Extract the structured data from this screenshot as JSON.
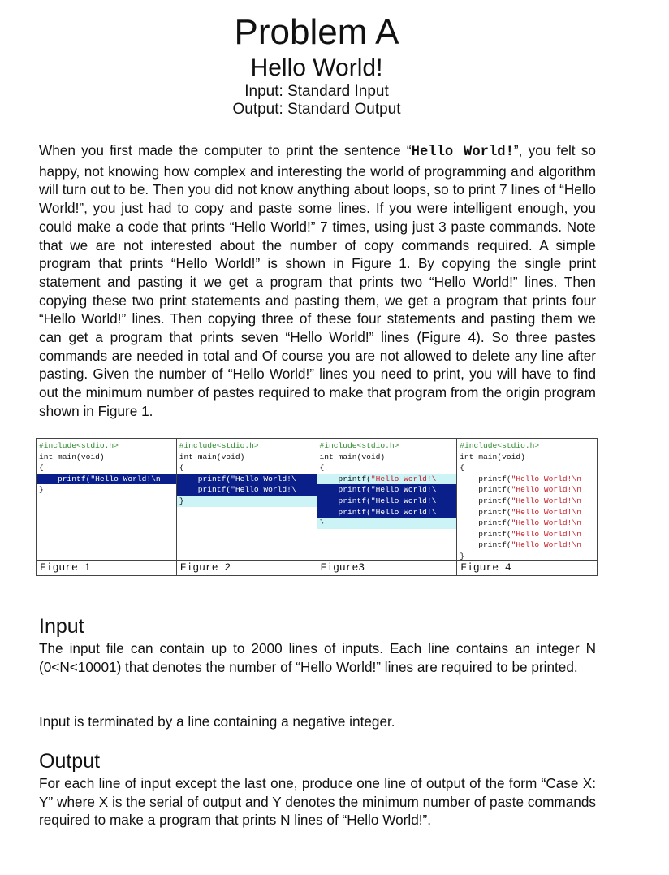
{
  "header": {
    "title": "Problem A",
    "subtitle": "Hello World!",
    "input_line": "Input: Standard Input",
    "output_line": "Output: Standard Output"
  },
  "intro": {
    "part1": "When you first made the computer to print the sentence “",
    "mono_text": "Hello World!",
    "part2": "”, you felt so happy, not knowing how complex and interesting the world of programming and algorithm will turn out to be. Then you did not know anything about loops, so to print 7 lines of “Hello World!”, you just had to copy and paste some lines. If you were intelligent enough, you could make a code that prints “Hello World!” 7 times, using just 3 paste commands. Note that we are not interested about the number of copy commands required. A simple program that prints “Hello World!” is shown in Figure 1. By copying the single print statement and pasting it we get a program that prints two “Hello World!” lines. Then copying these two print statements and pasting them, we get a program that prints four “Hello World!” lines. Then copying three of these four statements and pasting them we can get a program that prints seven “Hello World!” lines (Figure 4). So three pastes commands are needed in total and Of course you are not allowed to delete any line after pasting. Given the number of “Hello World!” lines you need to print, you will have to find out the minimum number of pastes required to make that program from the origin program shown in Figure 1."
  },
  "figures": [
    {
      "caption": "Figure 1",
      "lines": [
        {
          "text": "#include<stdio.h>",
          "kind": "include"
        },
        {
          "text": "int main(void)",
          "kind": "plain"
        },
        {
          "text": "{",
          "kind": "plain"
        },
        {
          "text": "    printf(\"Hello World!\\n",
          "kind": "sel"
        },
        {
          "text": "}",
          "kind": "plain"
        }
      ]
    },
    {
      "caption": "Figure 2",
      "lines": [
        {
          "text": "#include<stdio.h>",
          "kind": "include"
        },
        {
          "text": "int main(void)",
          "kind": "plain"
        },
        {
          "text": "{",
          "kind": "plain"
        },
        {
          "text": "    printf(\"Hello World!\\",
          "kind": "sel"
        },
        {
          "text": "    printf(\"Hello World!\\",
          "kind": "sel"
        },
        {
          "text": "}",
          "kind": "paste"
        }
      ]
    },
    {
      "caption": "Figure3",
      "lines": [
        {
          "text": "#include<stdio.h>",
          "kind": "include"
        },
        {
          "text": "int main(void)",
          "kind": "plain"
        },
        {
          "text": "{",
          "kind": "plain"
        },
        {
          "pre": "    printf(",
          "str": "\"Hello World!\\",
          "kind": "split"
        },
        {
          "text": "    printf(\"Hello World!\\",
          "kind": "sel"
        },
        {
          "text": "    printf(\"Hello World!\\",
          "kind": "sel"
        },
        {
          "text": "    printf(\"Hello World!\\",
          "kind": "sel"
        },
        {
          "text": "}",
          "kind": "paste"
        }
      ]
    },
    {
      "caption": "Figure 4",
      "lines": [
        {
          "text": "#include<stdio.h>",
          "kind": "include"
        },
        {
          "text": "int main(void)",
          "kind": "plain"
        },
        {
          "text": "{",
          "kind": "plain"
        },
        {
          "pre": "    printf(",
          "str": "\"Hello World!\\n",
          "kind": "code"
        },
        {
          "pre": "    printf(",
          "str": "\"Hello World!\\n",
          "kind": "code"
        },
        {
          "pre": "    printf(",
          "str": "\"Hello World!\\n",
          "kind": "code"
        },
        {
          "pre": "    printf(",
          "str": "\"Hello World!\\n",
          "kind": "code"
        },
        {
          "pre": "    printf(",
          "str": "\"Hello World!\\n",
          "kind": "code"
        },
        {
          "pre": "    printf(",
          "str": "\"Hello World!\\n",
          "kind": "code"
        },
        {
          "pre": "    printf(",
          "str": "\"Hello World!\\n",
          "kind": "code"
        },
        {
          "text": "}",
          "kind": "plain"
        }
      ]
    }
  ],
  "colors": {
    "selection_bg": "#0b1f8a",
    "paste_bg": "#ccf4f7",
    "include_text": "#2c8a2c",
    "string_text": "#c8202a"
  },
  "input": {
    "heading": "Input",
    "p1": "The input file can contain up to 2000 lines of inputs. Each line contains an integer N (0<N<10001) that denotes the number of “Hello World!” lines are required to be printed.",
    "p2": "Input is terminated by a line containing a negative integer."
  },
  "output": {
    "heading": "Output",
    "p1": "For each line of input except the last one, produce one line of output of the form “Case X: Y” where X is the serial of output and Y denotes the minimum number of paste commands required to make a program that prints N lines of “Hello World!”."
  }
}
